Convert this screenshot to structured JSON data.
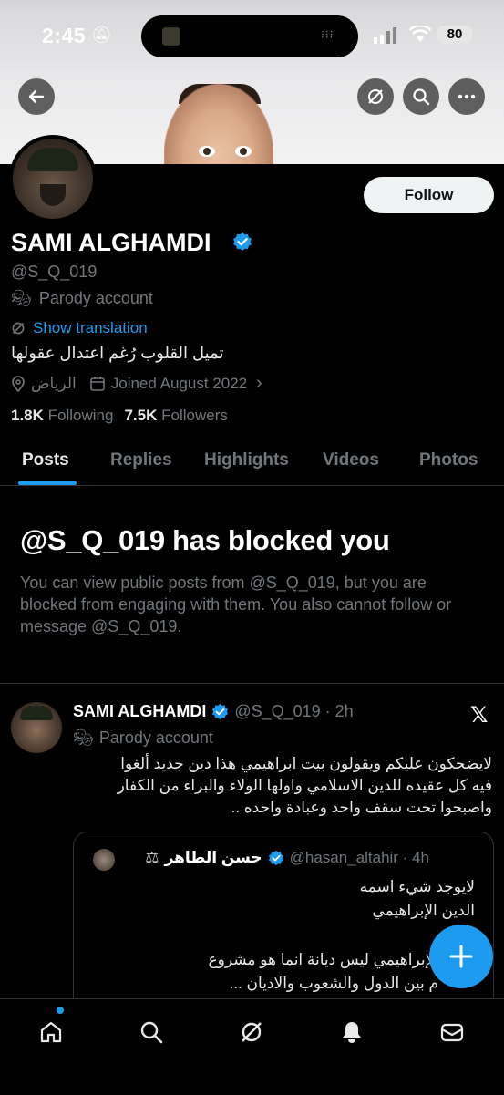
{
  "status_bar": {
    "time": "2:45",
    "battery": "80"
  },
  "profile": {
    "name": "SAMI ALGHAMDI",
    "handle": "@S_Q_019",
    "parody_label": "Parody account",
    "show_translation": "Show translation",
    "bio": "تميل القلوب رُغم اعتدال عقولها",
    "location": "الرياض",
    "joined": "Joined August 2022",
    "following_count": "1.8K",
    "following_label": "Following",
    "followers_count": "7.5K",
    "followers_label": "Followers",
    "follow_button": "Follow"
  },
  "tabs": [
    "Posts",
    "Replies",
    "Highlights",
    "Videos",
    "Photos"
  ],
  "blocked": {
    "title": "@S_Q_019 has blocked you",
    "description": "You can view public posts from @S_Q_019, but you are blocked from engaging with them. You also cannot follow or message @S_Q_019."
  },
  "tweet": {
    "name": "SAMI ALGHAMDI",
    "handle_time": "@S_Q_019 · 2h",
    "parody_label": "Parody account",
    "lines": [
      "لايضحكون عليكم ويقولون بيت ابراهيمي هذا دين جديد ألغوا",
      "فيه كل عقيده للدين الاسلامي واولها الولاء والبراء من الكفار",
      "واصبحوا تحت سقف واحد وعبادة واحده .."
    ],
    "quote": {
      "name": "حسن الطاهر",
      "handle_time": "@hasan_altahir · 4h",
      "lines": [
        "لايوجد شيء اسمه",
        "الدين الإبراهيمي",
        "الإبراهيمي ليس ديانة انما هو مشروع",
        "م بين الدول والشعوب والاديان ..."
      ]
    }
  },
  "icons": {
    "back": "arrow-left-icon",
    "grok": "grok-icon",
    "search": "search-icon",
    "more": "more-icon",
    "fab": "plus-icon"
  },
  "colors": {
    "accent": "#1d9bf0",
    "background": "#000000",
    "muted": "#71767b"
  }
}
